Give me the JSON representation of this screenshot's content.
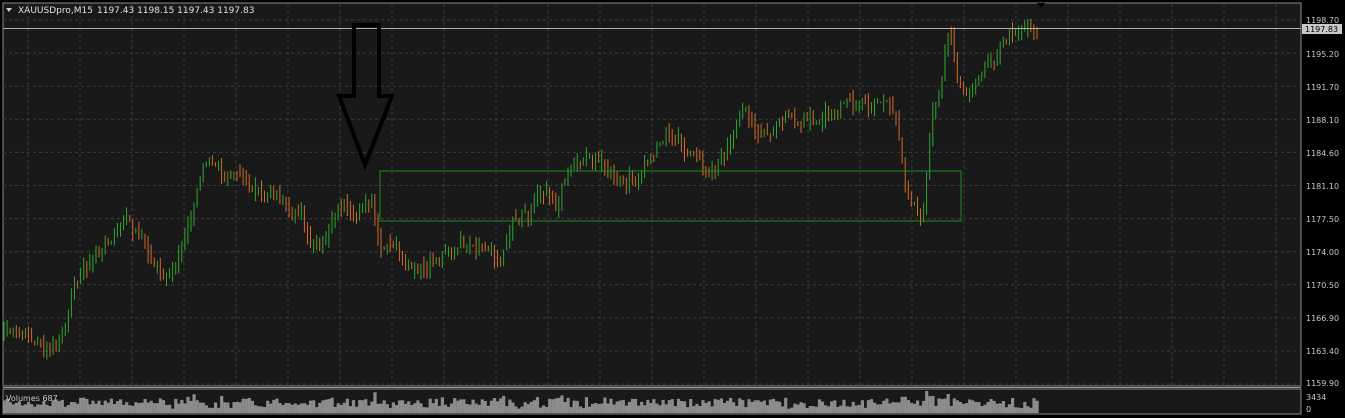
{
  "header": {
    "symbol": "XAUUSDpro,M15",
    "ohlc": "1197.43 1198.15 1197.43 1197.83"
  },
  "price_axis": {
    "ticks": [
      "1198.70",
      "1195.20",
      "1191.70",
      "1188.10",
      "1184.60",
      "1181.10",
      "1177.50",
      "1174.00",
      "1170.50",
      "1166.90",
      "1163.40",
      "1159.90"
    ],
    "current_price": "1197.83"
  },
  "volume_panel": {
    "label": "Volumes 687",
    "axis_ticks": [
      "3434",
      "0"
    ]
  },
  "colors": {
    "background": "#000000",
    "chart_background": "#191919",
    "grid": "#3c3c3c",
    "bull": "#2fa52f",
    "bear": "#cf6a2a",
    "range_box": "#1e8a1e",
    "arrow": "#000000",
    "volume": "#8c8c8c"
  },
  "chart_data": {
    "type": "candlestick",
    "ylim": [
      1159.9,
      1199.9
    ],
    "candles_count": 338,
    "anchor_prices": [
      1165.6,
      1166.2,
      1165.4,
      1164.6,
      1164.2,
      1163.4,
      1164.3,
      1166.6,
      1170.2,
      1172.3,
      1173.0,
      1174.0,
      1174.9,
      1176.3,
      1178.1,
      1176.1,
      1175.2,
      1172.8,
      1171.6,
      1171.9,
      1173.8,
      1176.3,
      1180.5,
      1183.5,
      1183.7,
      1182.4,
      1181.8,
      1181.9,
      1181.0,
      1181.1,
      1180.0,
      1179.9,
      1179.5,
      1177.8,
      1177.8,
      1174.9,
      1174.8,
      1176.2,
      1178.1,
      1179.2,
      1178.2,
      1178.2,
      1179.8,
      1174.4,
      1175.2,
      1174.6,
      1172.6,
      1172.7,
      1172.3,
      1172.8,
      1173.1,
      1174.0,
      1175.1,
      1175.2,
      1174.6,
      1174.4,
      1173.2,
      1173.5,
      1177.0,
      1177.5,
      1177.9,
      1179.9,
      1180.1,
      1178.6,
      1181.4,
      1183.3,
      1183.3,
      1184.2,
      1183.6,
      1182.4,
      1182.1,
      1181.7,
      1181.4,
      1183.2,
      1184.0,
      1185.6,
      1186.7,
      1185.8,
      1184.6,
      1184.6,
      1183.1,
      1182.3,
      1183.8,
      1186.2,
      1188.7,
      1189.0,
      1186.8,
      1186.5,
      1186.8,
      1188.1,
      1188.4,
      1187.8,
      1187.9,
      1188.0,
      1188.6,
      1188.9,
      1190.5,
      1189.2,
      1190.3,
      1189.3,
      1189.8,
      1190.0,
      1188.4,
      1179.8,
      1178.7,
      1177.9,
      1188.9,
      1191.6,
      1197.8,
      1192.4,
      1191.0,
      1192.1,
      1193.6,
      1194.4,
      1196.2,
      1197.5,
      1197.7,
      1197.6,
      1197.8
    ]
  }
}
